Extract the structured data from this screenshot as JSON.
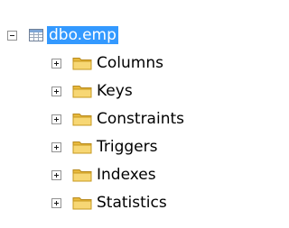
{
  "tree": {
    "root": {
      "label": "dbo.emp",
      "icon": "table-icon",
      "expanded": true,
      "selected": true
    },
    "children": [
      {
        "label": "Columns",
        "icon": "folder-icon",
        "expanded": false
      },
      {
        "label": "Keys",
        "icon": "folder-icon",
        "expanded": false
      },
      {
        "label": "Constraints",
        "icon": "folder-icon",
        "expanded": false
      },
      {
        "label": "Triggers",
        "icon": "folder-icon",
        "expanded": false
      },
      {
        "label": "Indexes",
        "icon": "folder-icon",
        "expanded": false
      },
      {
        "label": "Statistics",
        "icon": "folder-icon",
        "expanded": false
      }
    ]
  },
  "colors": {
    "selection": "#3399ff",
    "folder": "#f2c94c",
    "expander_border": "#919191"
  }
}
